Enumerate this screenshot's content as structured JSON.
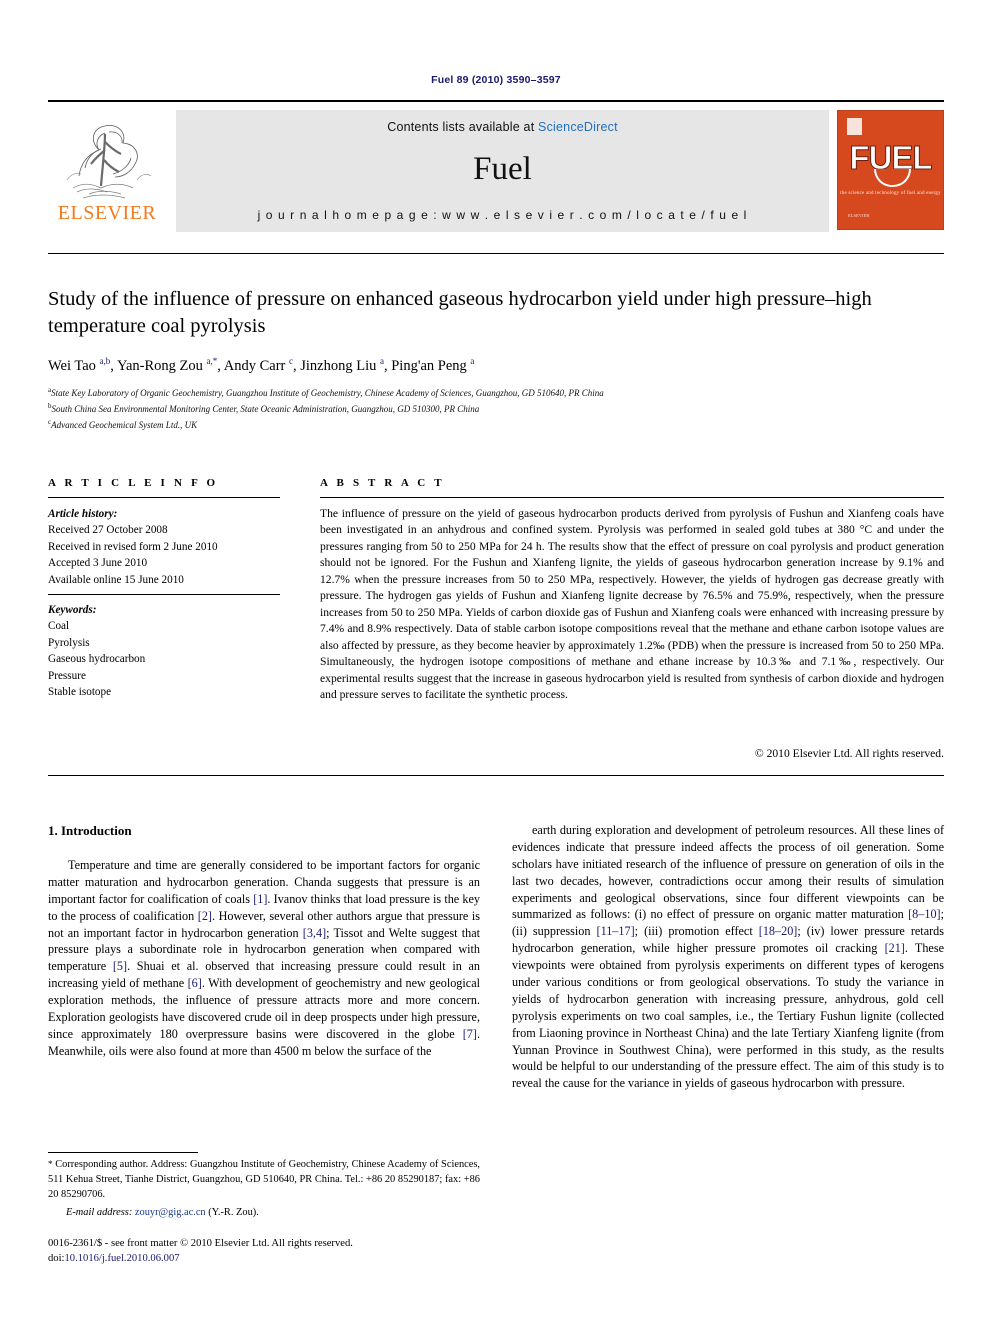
{
  "running_head": "Fuel 89 (2010) 3590–3597",
  "header": {
    "contents_prefix": "Contents lists available at ",
    "sciencedirect": "ScienceDirect",
    "journal_name": "Fuel",
    "homepage": "j o u r n a l   h o m e p a g e :   w w w . e l s e v i e r . c o m / l o c a t e / f u e l",
    "publisher": "ELSEVIER",
    "cover": {
      "title": "FUEL",
      "subtitle": "the science and technology of fuel and energy",
      "footer": "ELSEVIER"
    },
    "accent_orange": "#f47a1f",
    "cover_bg": "#d6491f",
    "link_blue": "#1f6fc4"
  },
  "article": {
    "title": "Study of the influence of pressure on enhanced gaseous hydrocarbon yield under high pressure–high temperature coal pyrolysis",
    "authors_html": "Wei Tao <sup>a,b</sup>, Yan-Rong Zou <sup>a,</sup><sup class=\"star\">*</sup>, Andy Carr <sup>c</sup>, Jinzhong Liu <sup>a</sup>, Ping'an Peng <sup>a</sup>",
    "affiliations": [
      {
        "marker": "a",
        "text": "State Key Laboratory of Organic Geochemistry, Guangzhou Institute of Geochemistry, Chinese Academy of Sciences, Guangzhou, GD 510640, PR China"
      },
      {
        "marker": "b",
        "text": "South China Sea Environmental Monitoring Center, State Oceanic Administration, Guangzhou, GD 510300, PR China"
      },
      {
        "marker": "c",
        "text": "Advanced Geochemical System Ltd., UK"
      }
    ]
  },
  "info": {
    "article_info_heading": "A R T I C L E    I N F O",
    "abstract_heading": "A B S T R A C T",
    "history_label": "Article history:",
    "history": [
      "Received 27 October 2008",
      "Received in revised form 2 June 2010",
      "Accepted 3 June 2010",
      "Available online 15 June 2010"
    ],
    "keywords_label": "Keywords:",
    "keywords": [
      "Coal",
      "Pyrolysis",
      "Gaseous hydrocarbon",
      "Pressure",
      "Stable isotope"
    ]
  },
  "abstract": {
    "text": "The influence of pressure on the yield of gaseous hydrocarbon products derived from pyrolysis of Fushun and Xianfeng coals have been investigated in an anhydrous and confined system. Pyrolysis was performed in sealed gold tubes at 380 °C and under the pressures ranging from 50 to 250 MPa for 24 h. The results show that the effect of pressure on coal pyrolysis and product generation should not be ignored. For the Fushun and Xianfeng lignite, the yields of gaseous hydrocarbon generation increase by 9.1% and 12.7% when the pressure increases from 50 to 250 MPa, respectively. However, the yields of hydrogen gas decrease greatly with pressure. The hydrogen gas yields of Fushun and Xianfeng lignite decrease by 76.5% and 75.9%, respectively, when the pressure increases from 50 to 250 MPa. Yields of carbon dioxide gas of Fushun and Xianfeng coals were enhanced with increasing pressure by 7.4% and 8.9% respectively. Data of stable carbon isotope compositions reveal that the methane and ethane carbon isotope values are also affected by pressure, as they become heavier by approximately 1.2‰ (PDB) when the pressure is increased from 50 to 250 MPa. Simultaneously, the hydrogen isotope compositions of methane and ethane increase by 10.3‰ and 7.1‰, respectively. Our experimental results suggest that the increase in gaseous hydrocarbon yield is resulted from synthesis of carbon dioxide and hydrogen and pressure serves to facilitate the synthetic process.",
    "copyright": "© 2010 Elsevier Ltd. All rights reserved."
  },
  "body": {
    "section_title": "1. Introduction",
    "left_paragraph_html": "Temperature and time are generally considered to be important factors for organic matter maturation and hydrocarbon generation. Chanda suggests that pressure is an important factor for coalification of coals <span class=\"ref\">[1]</span>. Ivanov thinks that load pressure is the key to the process of coalification <span class=\"ref\">[2]</span>. However, several other authors argue that pressure is not an important factor in hydrocarbon generation <span class=\"ref\">[3,4]</span>; Tissot and Welte suggest that pressure plays a subordinate role in hydrocarbon generation when compared with temperature <span class=\"ref\">[5]</span>. Shuai et al. observed that increasing pressure could result in an increasing yield of methane <span class=\"ref\">[6]</span>. With development of geochemistry and new geological exploration methods, the influence of pressure attracts more and more concern. Exploration geologists have discovered crude oil in deep prospects under high pressure, since approximately 180 overpressure basins were discovered in the globe <span class=\"ref\">[7]</span>. Meanwhile, oils were also found at more than 4500 m below the surface of the",
    "right_paragraph_html": "earth during exploration and development of petroleum resources. All these lines of evidences indicate that pressure indeed affects the process of oil generation. Some scholars have initiated research of the influence of pressure on generation of oils in the last two decades, however, contradictions occur among their results of simulation experiments and geological observations, since four different viewpoints can be summarized as follows: (i) no effect of pressure on organic matter maturation <span class=\"ref\">[8–10]</span>; (ii) suppression <span class=\"ref\">[11–17]</span>; (iii) promotion effect <span class=\"ref\">[18–20]</span>; (iv) lower pressure retards hydrocarbon generation, while higher pressure promotes oil cracking <span class=\"ref\">[21]</span>. These viewpoints were obtained from pyrolysis experiments on different types of kerogens under various conditions or from geological observations. To study the variance in yields of hydrocarbon generation with increasing pressure, anhydrous, gold cell pyrolysis experiments on two coal samples, i.e., the Tertiary Fushun lignite (collected from Liaoning province in Northeast China) and the late Tertiary Xianfeng lignite (from Yunnan Province in Southwest China), were performed in this study, as the results would be helpful to our understanding of the pressure effect. The aim of this study is to reveal the cause for the variance in yields of gaseous hydrocarbon with pressure."
  },
  "footnote": {
    "corresponding_html": "<span class=\"star\">*</span> Corresponding author. Address: Guangzhou Institute of Geochemistry, Chinese Academy of Sciences, 511 Kehua Street, Tianhe District, Guangzhou, GD 510640, PR China. Tel.: +86 20 85290187; fax: +86 20 85290706.",
    "email_label": "E-mail address:",
    "email": "zouyr@gig.ac.cn",
    "email_owner": "(Y.-R. Zou).",
    "issn_line": "0016-2361/$ - see front matter © 2010 Elsevier Ltd. All rights reserved.",
    "doi_label": "doi:",
    "doi": "10.1016/j.fuel.2010.06.007"
  }
}
